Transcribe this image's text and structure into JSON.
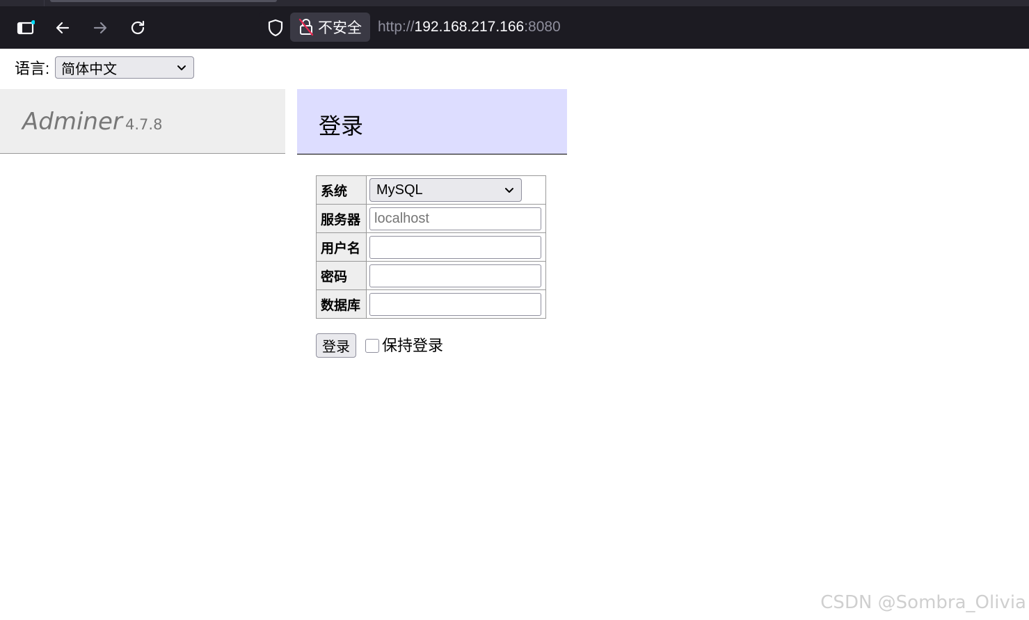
{
  "browser": {
    "security_label": "不安全",
    "url_scheme": "http://",
    "url_host": "192.168.217.166",
    "url_port": ":8080",
    "icons": [
      "sidebar-icon",
      "back-icon",
      "forward-icon",
      "reload-icon",
      "shield-icon",
      "insecure-lock-icon"
    ]
  },
  "language": {
    "label": "语言:",
    "selected": "简体中文"
  },
  "brand": {
    "name": "Adminer",
    "version": "4.7.8"
  },
  "page": {
    "heading": "登录"
  },
  "login_form": {
    "system_label": "系统",
    "system_value": "MySQL",
    "server_label": "服务器",
    "server_placeholder": "localhost",
    "username_label": "用户名",
    "username_value": "",
    "password_label": "密码",
    "password_value": "",
    "database_label": "数据库",
    "database_value": "",
    "submit_label": "登录",
    "remember_label": "保持登录",
    "remember_checked": false
  },
  "watermark": "CSDN @Sombra_Olivia",
  "colors": {
    "chrome_bg": "#1c1b22",
    "brand_bg": "#eeeeee",
    "heading_bg": "#ddddff",
    "security_badge_bg": "#3a3944"
  }
}
